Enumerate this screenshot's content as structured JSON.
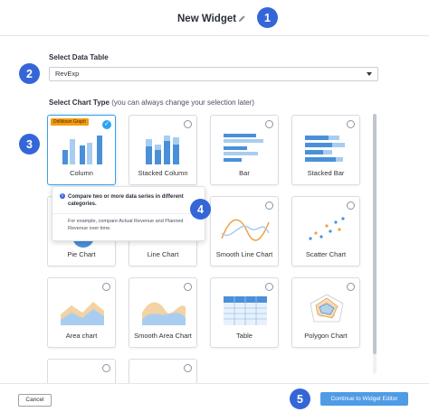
{
  "header": {
    "title": "New Widget",
    "edit_icon": "pencil-icon"
  },
  "steps": [
    "1",
    "2",
    "3",
    "4",
    "5"
  ],
  "data_table": {
    "label": "Select Data Table",
    "value": "RevExp"
  },
  "chart_type": {
    "label": "Select Chart Type",
    "hint": "(you can always change your selection later)",
    "cards": [
      {
        "label": "Column",
        "badge": "Drilldown Graph",
        "selected": true
      },
      {
        "label": "Stacked Column"
      },
      {
        "label": "Bar"
      },
      {
        "label": "Stacked Bar"
      },
      {
        "label": "Pie Chart"
      },
      {
        "label": "Line Chart"
      },
      {
        "label": "Smooth Line Chart"
      },
      {
        "label": "Scatter Chart"
      },
      {
        "label": "Area chart"
      },
      {
        "label": "Smooth Area Chart"
      },
      {
        "label": "Table"
      },
      {
        "label": "Polygon Chart"
      },
      {
        "label": ""
      },
      {
        "label": ""
      }
    ]
  },
  "tooltip": {
    "heading": "Compare two or more data series in different categories.",
    "body": "For example, compare Actual Revenue and Planned Revenue over time."
  },
  "footer": {
    "cancel_label": "Cancel",
    "continue_label": "Continue to Widget Editor"
  },
  "colors": {
    "accent": "#3566d8",
    "chart_blue": "#4a90d9",
    "selected_border": "#3aa0e8",
    "badge": "#f39c12",
    "primary_button": "#4f9be6"
  }
}
